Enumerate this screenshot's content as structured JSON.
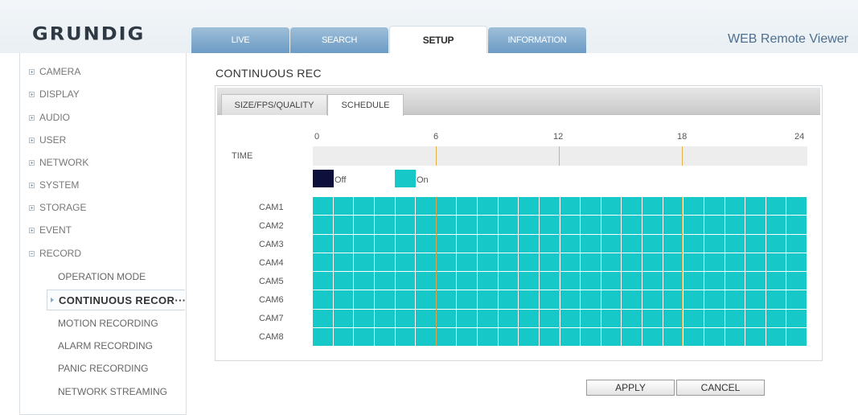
{
  "header": {
    "logo_text": "GRUNDIG",
    "brand_right": "WEB Remote Viewer",
    "tabs": [
      {
        "label": "LIVE",
        "active": false
      },
      {
        "label": "SEARCH",
        "active": false
      },
      {
        "label": "SETUP",
        "active": true
      },
      {
        "label": "INFORMATION",
        "active": false
      }
    ]
  },
  "sidebar": {
    "items": [
      {
        "label": "CAMERA",
        "expanded": false
      },
      {
        "label": "DISPLAY",
        "expanded": false
      },
      {
        "label": "AUDIO",
        "expanded": false
      },
      {
        "label": "USER",
        "expanded": false
      },
      {
        "label": "NETWORK",
        "expanded": false
      },
      {
        "label": "SYSTEM",
        "expanded": false
      },
      {
        "label": "STORAGE",
        "expanded": false
      },
      {
        "label": "EVENT",
        "expanded": false
      },
      {
        "label": "RECORD",
        "expanded": true
      }
    ],
    "record_sub": [
      {
        "label": "OPERATION MODE"
      },
      {
        "label": "CONTINUOUS RECOR···",
        "active": true
      },
      {
        "label": "MOTION RECORDING"
      },
      {
        "label": "ALARM RECORDING"
      },
      {
        "label": "PANIC RECORDING"
      },
      {
        "label": "NETWORK STREAMING"
      }
    ]
  },
  "main": {
    "title": "CONTINUOUS REC",
    "subtabs": [
      {
        "label": "SIZE/FPS/QUALITY",
        "active": false
      },
      {
        "label": "SCHEDULE",
        "active": true
      }
    ],
    "schedule": {
      "time_label": "TIME",
      "ticks": [
        "0",
        "6",
        "12",
        "18",
        "24"
      ],
      "legend": [
        {
          "label": "Off",
          "color": "#0f0f3c"
        },
        {
          "label": "On",
          "color": "#17c8c8"
        }
      ],
      "cameras": [
        "CAM1",
        "CAM2",
        "CAM3",
        "CAM4",
        "CAM5",
        "CAM6",
        "CAM7",
        "CAM8"
      ],
      "hours": 24,
      "state": "On"
    }
  },
  "buttons": {
    "apply": "APPLY",
    "cancel": "CANCEL"
  },
  "colors": {
    "on": "#17c8c8",
    "off": "#0f0f3c",
    "tab_blue": "#7aa6cc",
    "marker": "#e5b04a"
  }
}
